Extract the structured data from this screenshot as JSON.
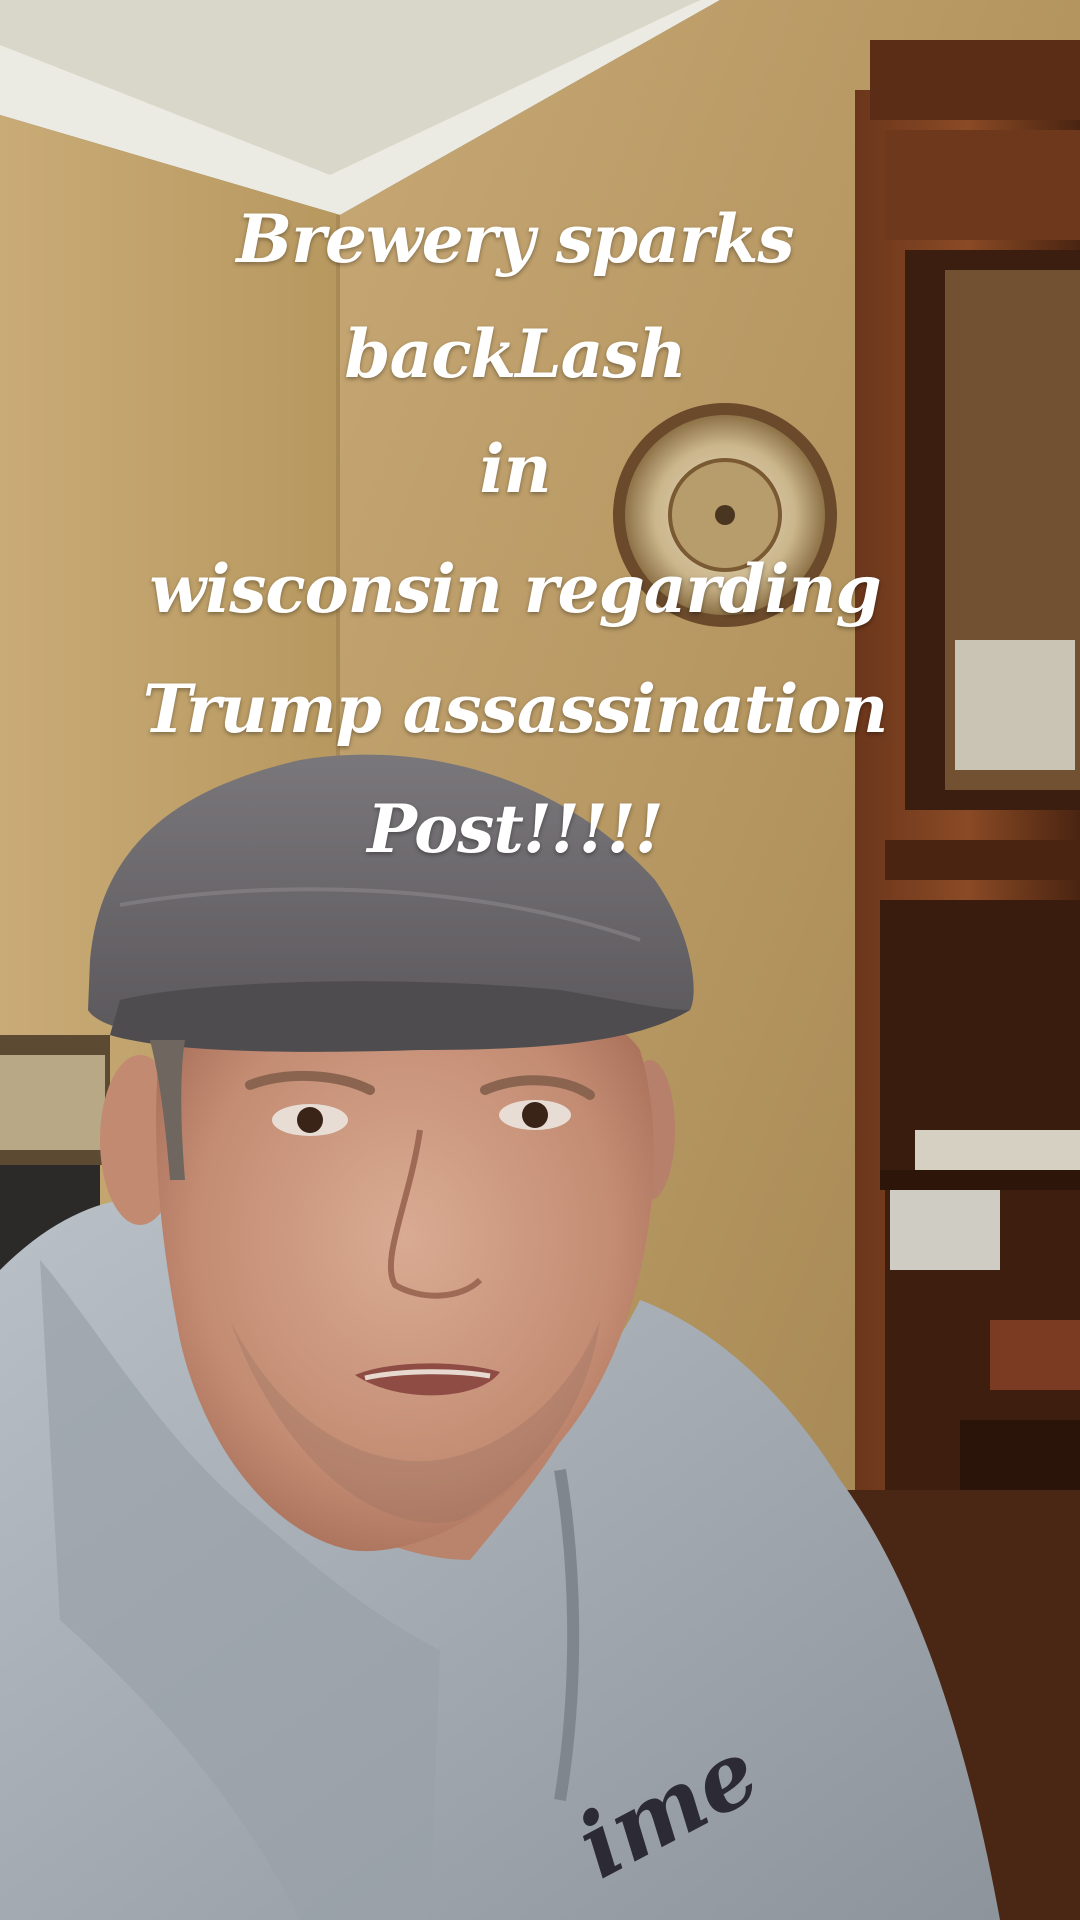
{
  "overlay_caption": {
    "lines": [
      "Brewery sparks",
      "backLash",
      "in",
      "wisconsin regarding",
      "Trump assassination",
      "Post!!!!!"
    ]
  },
  "sweatshirt_text": "ime",
  "colors": {
    "caption_text": "#ffffff",
    "wall": "#b89a66",
    "ceiling": "#d8d6c8",
    "cabinet_wood": "#5a2e17",
    "cap_gray": "#6d6a6e",
    "hoodie_gray": "#a7adb4"
  }
}
